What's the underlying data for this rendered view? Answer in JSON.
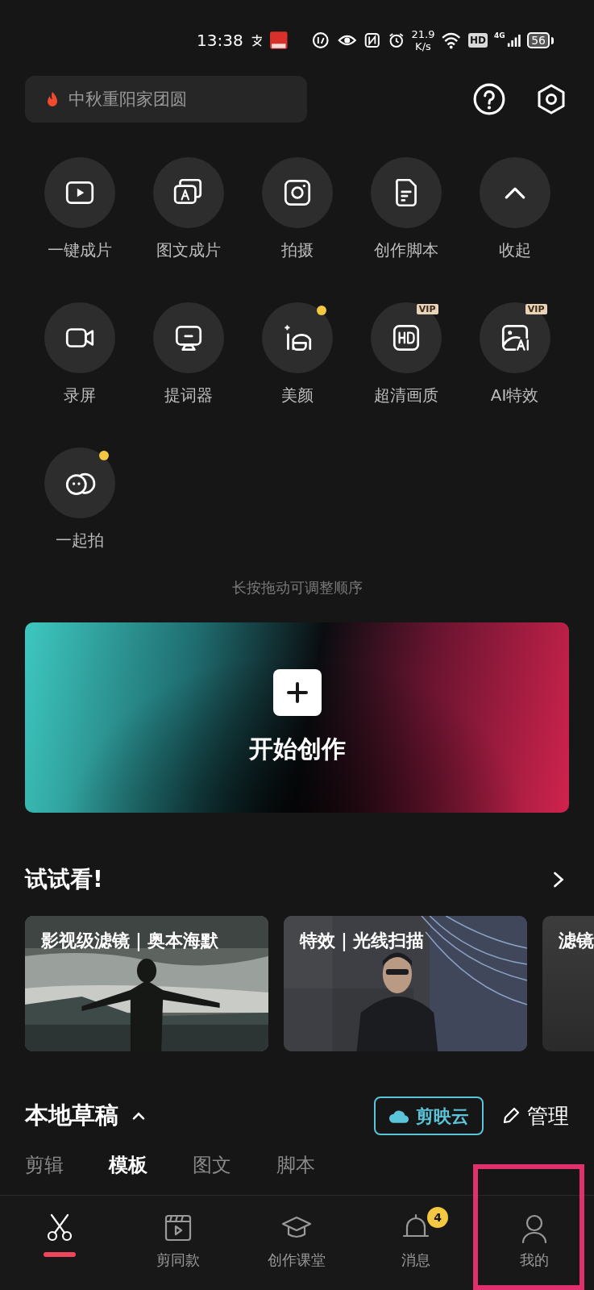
{
  "status_bar": {
    "time": "13:38",
    "speed": "21.9",
    "speed_unit": "K/s",
    "hd": "HD",
    "network": "4G",
    "battery": "56"
  },
  "search": {
    "placeholder": "中秋重阳家团圆"
  },
  "tools": [
    {
      "label": "一键成片",
      "dot": false
    },
    {
      "label": "图文成片",
      "dot": false
    },
    {
      "label": "拍摄",
      "dot": false
    },
    {
      "label": "创作脚本",
      "dot": false
    },
    {
      "label": "收起",
      "dot": false
    },
    {
      "label": "录屏",
      "dot": false
    },
    {
      "label": "提词器",
      "dot": false
    },
    {
      "label": "美颜",
      "dot": true
    },
    {
      "label": "超清画质",
      "dot": false,
      "vip_text": "VIP"
    },
    {
      "label": "AI特效",
      "dot": false,
      "vip_text": "VIP"
    },
    {
      "label": "一起拍",
      "dot": true
    }
  ],
  "hint": "长按拖动可调整顺序",
  "create_button": {
    "label": "开始创作"
  },
  "try_section": {
    "title": "试试看!",
    "cards": [
      {
        "title": "影视级滤镜｜奥本海默",
        "kind": "picture"
      },
      {
        "title": "特效｜光线扫描",
        "kind": "picture"
      },
      {
        "title": "滤镜",
        "kind": "plain"
      }
    ]
  },
  "drafts": {
    "title": "本地草稿",
    "cloud_button": "剪映云",
    "manage_button": "管理",
    "tabs": [
      {
        "label": "剪辑",
        "selected": false
      },
      {
        "label": "模板",
        "selected": true
      },
      {
        "label": "图文",
        "selected": false
      },
      {
        "label": "脚本",
        "selected": false
      }
    ]
  },
  "bottom_nav": [
    {
      "selected": true
    },
    {
      "label": "剪同款",
      "selected": false
    },
    {
      "label": "创作课堂",
      "selected": false
    },
    {
      "label": "消息",
      "selected": false,
      "badge": "4"
    },
    {
      "label": "我的",
      "selected": false
    }
  ]
}
